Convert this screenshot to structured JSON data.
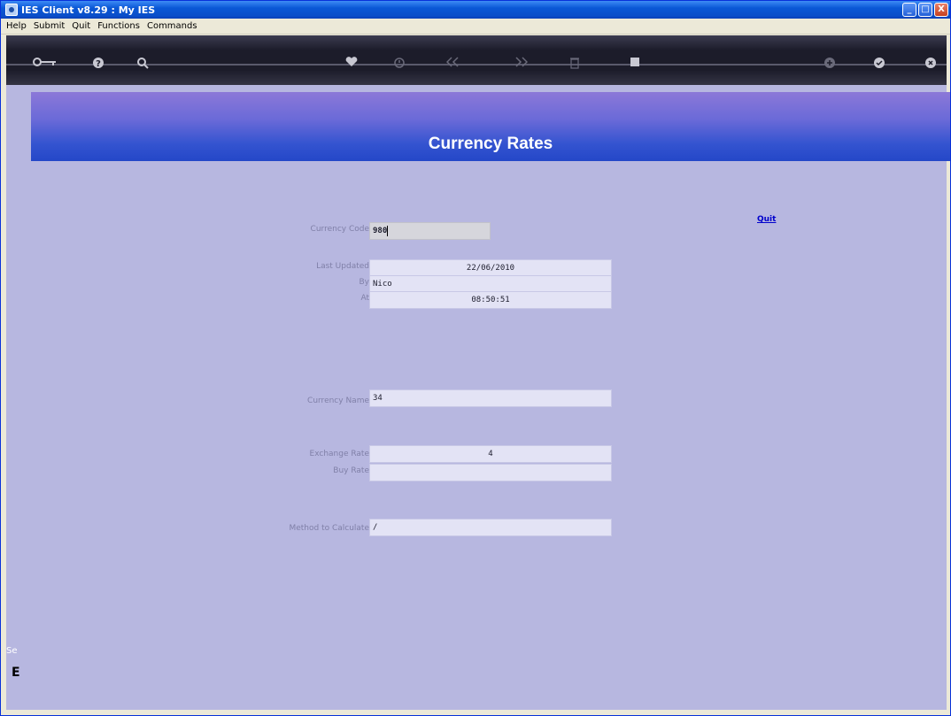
{
  "window": {
    "title": "IES Client v8.29 : My IES",
    "minimize": "_",
    "maximize": "□",
    "close": "X"
  },
  "menu": [
    "Help",
    "Submit",
    "Quit",
    "Functions",
    "Commands"
  ],
  "toolbar": {
    "icons": [
      "key-icon",
      "help-icon",
      "search-icon",
      "heart-icon",
      "clock-icon",
      "rewind-icon",
      "fast-forward-icon",
      "trash-icon",
      "stop-icon",
      "plus-icon",
      "check-icon",
      "close-icon"
    ]
  },
  "banner": {
    "title": "Currency Rates"
  },
  "quit_link": "Quit",
  "form": {
    "currency_code": {
      "label": "Currency Code",
      "value": "980"
    },
    "last_updated": {
      "label": "Last Updated",
      "value": "22/06/2010"
    },
    "by": {
      "label": "By",
      "value": "Nico"
    },
    "at": {
      "label": "At",
      "value": "08:50:51"
    },
    "currency_name": {
      "label": "Currency Name",
      "value": "34"
    },
    "exchange_rate": {
      "label": "Exchange Rate",
      "value": "4"
    },
    "buy_rate": {
      "label": "Buy Rate",
      "value": ""
    },
    "method": {
      "label": "Method to Calculate",
      "value": "/"
    }
  },
  "side": {
    "text1": "Se",
    "text2": "E"
  }
}
